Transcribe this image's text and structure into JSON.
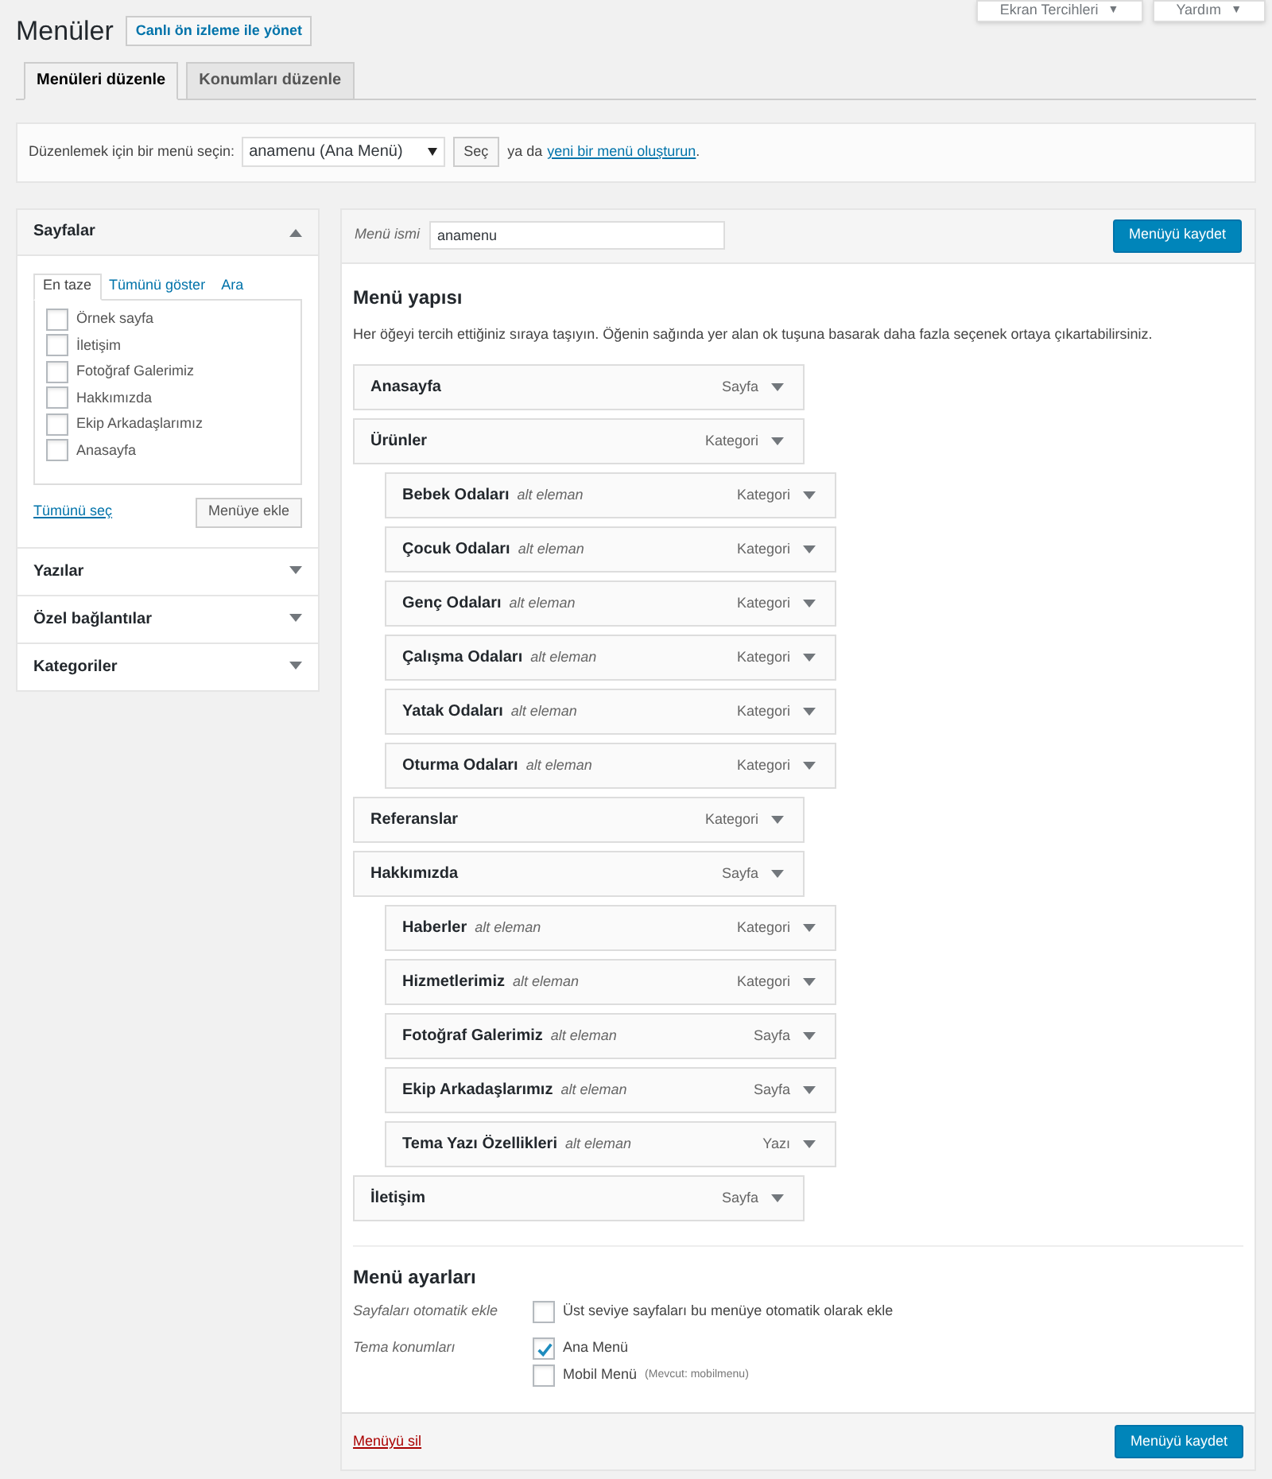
{
  "page_title": "Menüler",
  "live_preview_button": "Canlı ön izleme ile yönet",
  "top_buttons": [
    {
      "label": "Ekran Tercihleri",
      "caret": "▼"
    },
    {
      "label": "Yardım",
      "caret": "▼"
    }
  ],
  "tabs": [
    {
      "label": "Menüleri düzenle",
      "selected": true
    },
    {
      "label": "Konumları düzenle",
      "selected": false
    }
  ],
  "menu_picker": {
    "label": "Düzenlemek için bir menü seçin:",
    "value": "anamenu (Ana Menü)",
    "button": "Seç",
    "or_text": "ya da",
    "create_link": "yeni bir menü oluşturun",
    "after": "."
  },
  "sidebar": {
    "sections": [
      {
        "title": "Sayfalar",
        "expanded": true
      },
      {
        "title": "Yazılar",
        "expanded": false
      },
      {
        "title": "Özel bağlantılar",
        "expanded": false
      },
      {
        "title": "Kategoriler",
        "expanded": false
      }
    ],
    "tabs": [
      {
        "label": "En taze",
        "selected": true
      },
      {
        "label": "Tümünü göster",
        "selected": false
      },
      {
        "label": "Ara",
        "selected": false
      }
    ],
    "pages": [
      {
        "label": "Örnek sayfa",
        "checked": false
      },
      {
        "label": "İletişim",
        "checked": false
      },
      {
        "label": "Fotoğraf Galerimiz",
        "checked": false
      },
      {
        "label": "Hakkımızda",
        "checked": false
      },
      {
        "label": "Ekip Arkadaşlarımız",
        "checked": false
      },
      {
        "label": "Anasayfa",
        "checked": false
      }
    ],
    "select_all": "Tümünü seç",
    "add_button": "Menüye ekle"
  },
  "editor": {
    "name_label": "Menü ismi",
    "name_value": "anamenu",
    "save_button": "Menüyü kaydet",
    "structure_title": "Menü yapısı",
    "structure_help": "Her öğeyi tercih ettiğiniz sıraya taşıyın. Öğenin sağında yer alan ok tuşuna basarak daha fazla seçenek ortaya çıkartabilirsiniz.",
    "items": [
      {
        "title": "Anasayfa",
        "type": "Sayfa"
      },
      {
        "title": "Ürünler",
        "type": "Kategori",
        "children": [
          {
            "title": "Bebek Odaları",
            "sub": "alt eleman",
            "type": "Kategori"
          },
          {
            "title": "Çocuk Odaları",
            "sub": "alt eleman",
            "type": "Kategori"
          },
          {
            "title": "Genç Odaları",
            "sub": "alt eleman",
            "type": "Kategori"
          },
          {
            "title": "Çalışma Odaları",
            "sub": "alt eleman",
            "type": "Kategori"
          },
          {
            "title": "Yatak Odaları",
            "sub": "alt eleman",
            "type": "Kategori"
          },
          {
            "title": "Oturma Odaları",
            "sub": "alt eleman",
            "type": "Kategori"
          }
        ]
      },
      {
        "title": "Referanslar",
        "type": "Kategori"
      },
      {
        "title": "Hakkımızda",
        "type": "Sayfa",
        "children": [
          {
            "title": "Haberler",
            "sub": "alt eleman",
            "type": "Kategori"
          },
          {
            "title": "Hizmetlerimiz",
            "sub": "alt eleman",
            "type": "Kategori"
          },
          {
            "title": "Fotoğraf Galerimiz",
            "sub": "alt eleman",
            "type": "Sayfa"
          },
          {
            "title": "Ekip Arkadaşlarımız",
            "sub": "alt eleman",
            "type": "Sayfa"
          },
          {
            "title": "Tema Yazı Özellikleri",
            "sub": "alt eleman",
            "type": "Yazı"
          }
        ]
      },
      {
        "title": "İletişim",
        "type": "Sayfa"
      }
    ],
    "settings_title": "Menü ayarları",
    "auto_add": {
      "label": "Sayfaları otomatik ekle",
      "option": "Üst seviye sayfaları bu menüye otomatik olarak ekle",
      "checked": false
    },
    "locations": {
      "label": "Tema konumları",
      "options": [
        {
          "label": "Ana Menü",
          "checked": true
        },
        {
          "label": "Mobil Menü",
          "note": "(Mevcut: mobilmenu)",
          "checked": false
        }
      ]
    },
    "delete_link": "Menüyü sil",
    "save_button_bottom": "Menüyü kaydet"
  }
}
